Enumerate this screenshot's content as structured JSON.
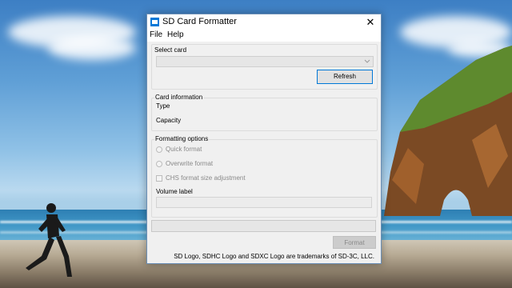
{
  "window": {
    "title": "SD Card Formatter",
    "close_glyph": "✕",
    "app_icon": "sd-card-icon"
  },
  "menu": {
    "file": "File",
    "help": "Help"
  },
  "select_card": {
    "label": "Select card",
    "value": "",
    "arrow_icon": "chevron-down-icon",
    "refresh_label": "Refresh"
  },
  "card_information": {
    "legend": "Card information",
    "type_label": "Type",
    "capacity_label": "Capacity"
  },
  "formatting_options": {
    "legend": "Formatting options",
    "quick_format": "Quick format",
    "overwrite_format": "Overwrite format",
    "chs_adjustment": "CHS format size adjustment",
    "volume_label": "Volume label",
    "volume_value": ""
  },
  "progress": {
    "fraction": 0
  },
  "format_button": "Format",
  "footer": "SD Logo, SDHC Logo and SDXC Logo are trademarks of SD-3C, LLC.",
  "colors": {
    "accent": "#0078d7",
    "disabled_text": "#8a8a8a",
    "window_bg": "#f0f0f0"
  }
}
